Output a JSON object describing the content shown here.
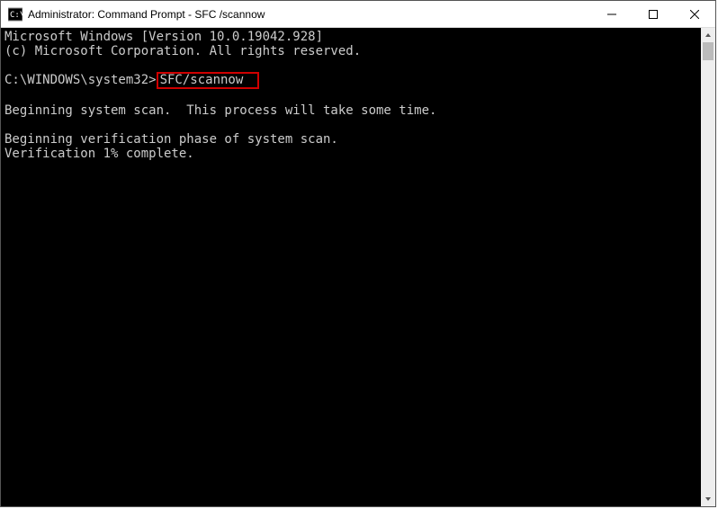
{
  "window": {
    "title": "Administrator: Command Prompt - SFC /scannow"
  },
  "terminal": {
    "line1": "Microsoft Windows [Version 10.0.19042.928]",
    "line2": "(c) Microsoft Corporation. All rights reserved.",
    "blank": "",
    "prompt_prefix": "C:\\WINDOWS\\system32>",
    "command": "SFC/scannow",
    "line4": "Beginning system scan.  This process will take some time.",
    "line5": "Beginning verification phase of system scan.",
    "line6": "Verification 1% complete."
  },
  "colors": {
    "highlight": "#d00000"
  }
}
